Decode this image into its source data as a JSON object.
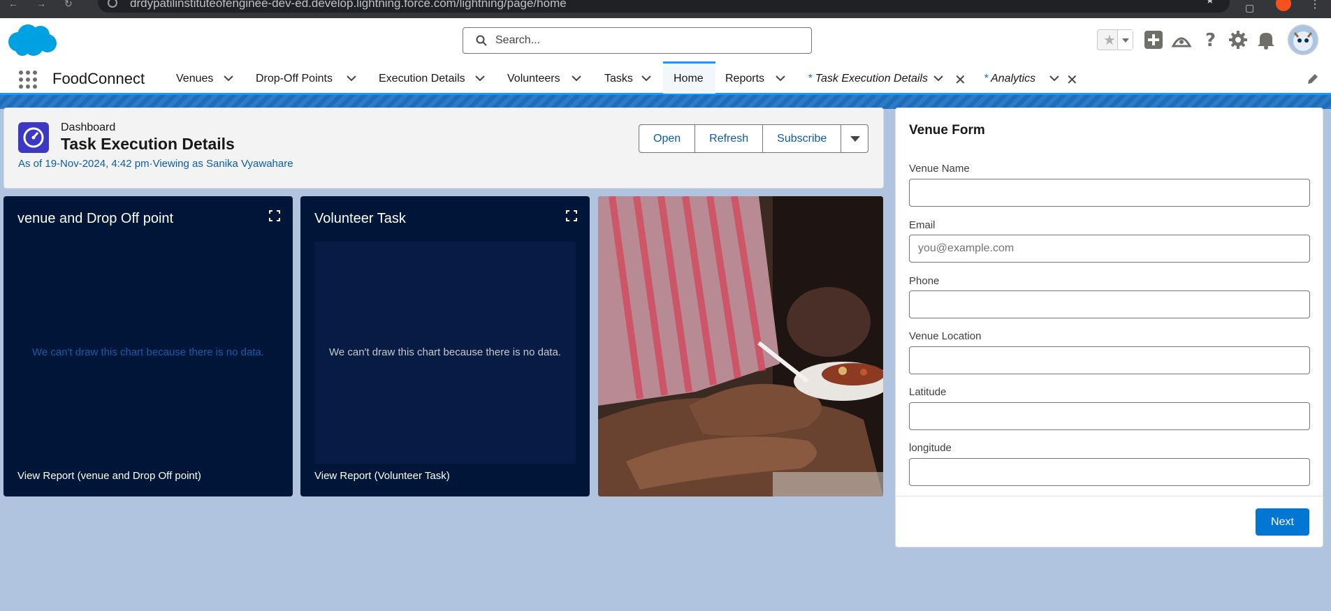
{
  "browser": {
    "url": "drdypatilinstituteofenginee-dev-ed.develop.lightning.force.com/lightning/page/home"
  },
  "header": {
    "search_placeholder": "Search...",
    "icons": [
      "favorites-star-icon",
      "add-icon",
      "trailhead-icon",
      "help-icon",
      "setup-gear-icon",
      "notifications-bell-icon",
      "user-avatar"
    ]
  },
  "nav": {
    "app_name": "FoodConnect",
    "items": [
      {
        "label": "Venues"
      },
      {
        "label": "Drop-Off Points"
      },
      {
        "label": "Execution Details"
      },
      {
        "label": "Volunteers"
      },
      {
        "label": "Tasks"
      },
      {
        "label": "Home"
      },
      {
        "label": "Reports"
      },
      {
        "label": "Task Execution Details",
        "asterisk": "*"
      },
      {
        "label": "Analytics",
        "asterisk": "*"
      }
    ]
  },
  "dashboard": {
    "kicker": "Dashboard",
    "title": "Task Execution Details",
    "meta": "As of 19-Nov-2024, 4:42 pm·Viewing as Sanika Vyawahare",
    "buttons": {
      "open": "Open",
      "refresh": "Refresh",
      "subscribe": "Subscribe"
    }
  },
  "cards": [
    {
      "title": "venue and Drop Off point",
      "nodata": "We can't draw this chart because there is no data.",
      "view_report": "View Report (venue and Drop Off point)"
    },
    {
      "title": "Volunteer Task",
      "nodata": "We can't draw this chart because there is no data.",
      "view_report": "View Report (Volunteer Task)"
    }
  ],
  "venue_form": {
    "title": "Venue Form",
    "fields": [
      {
        "label": "Venue Name",
        "value": "",
        "placeholder": ""
      },
      {
        "label": "Email",
        "value": "",
        "placeholder": "you@example.com"
      },
      {
        "label": "Phone",
        "value": "",
        "placeholder": ""
      },
      {
        "label": "Venue Location",
        "value": "",
        "placeholder": ""
      },
      {
        "label": "Latitude",
        "value": "",
        "placeholder": ""
      },
      {
        "label": "longitude",
        "value": "",
        "placeholder": ""
      }
    ],
    "next_label": "Next"
  },
  "colors": {
    "brand_blue": "#0176d3",
    "card_bg": "#001639",
    "page_bg": "#b0c4df"
  }
}
